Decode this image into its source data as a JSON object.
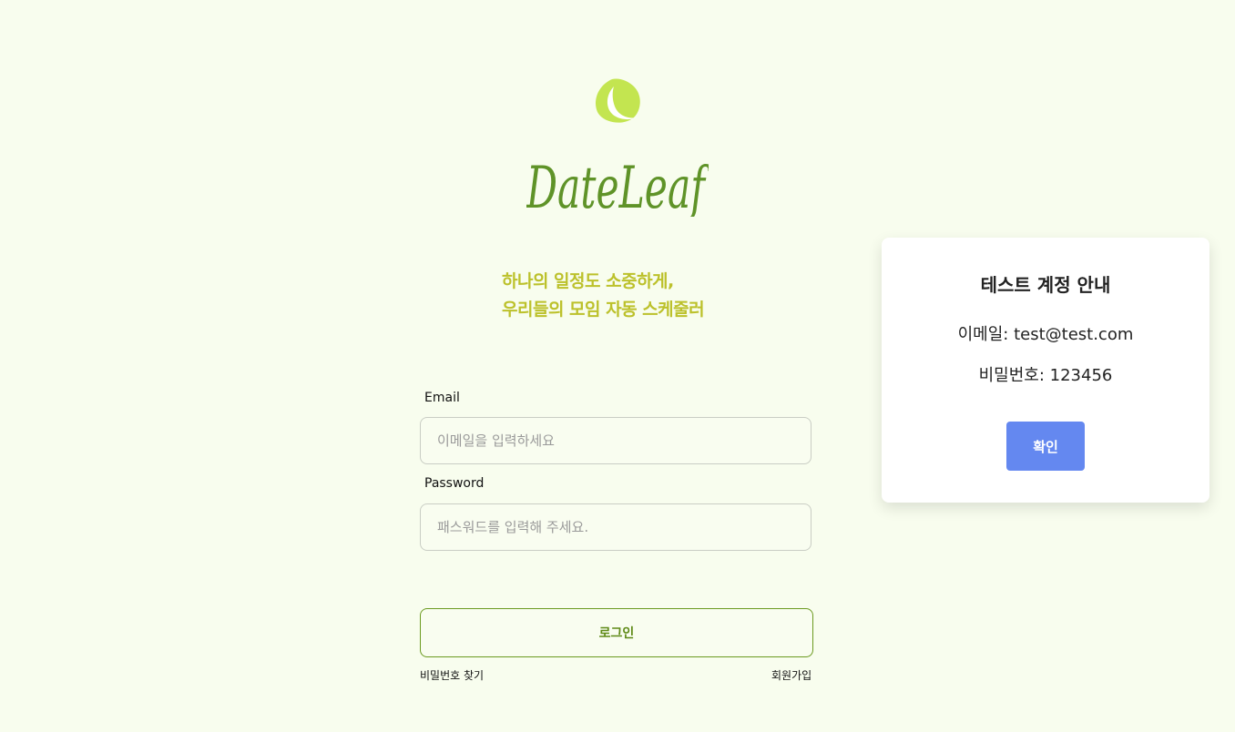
{
  "brand": {
    "logo_text": "DateLeaf",
    "logo_color": "#5f9328",
    "leaf_color": "#c3e550"
  },
  "tagline": {
    "line1": "하나의 일정도 소중하게,",
    "line2": "우리들의 모임 자동 스케줄러",
    "color": "#bcc12b"
  },
  "login_form": {
    "email_label": "Email",
    "email_placeholder": "이메일을 입력하세요",
    "password_label": "Password",
    "password_placeholder": "패스워드를 입력해 주세요.",
    "login_button": "로그인",
    "find_password_link": "비밀번호 찾기",
    "signup_link": "회원가입"
  },
  "test_account_modal": {
    "title": "테스트 계정 안내",
    "email_line": "이메일: test@test.com",
    "password_line": "비밀번호: 123456",
    "confirm_button": "확인",
    "confirm_color": "#6488f0"
  }
}
